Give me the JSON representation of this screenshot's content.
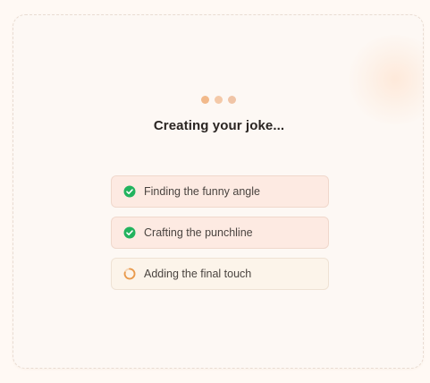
{
  "loader": {
    "title": "Creating your joke...",
    "steps": [
      {
        "label": "Finding the funny angle",
        "status": "done"
      },
      {
        "label": "Crafting the punchline",
        "status": "done"
      },
      {
        "label": "Adding the final touch",
        "status": "in-progress"
      }
    ]
  },
  "icons": {
    "done": "check-circle-icon",
    "in_progress": "spinner-icon"
  },
  "colors": {
    "check_green": "#22b35e",
    "spinner_orange": "#e99a4c",
    "dot_accent": "#f2b98a"
  }
}
